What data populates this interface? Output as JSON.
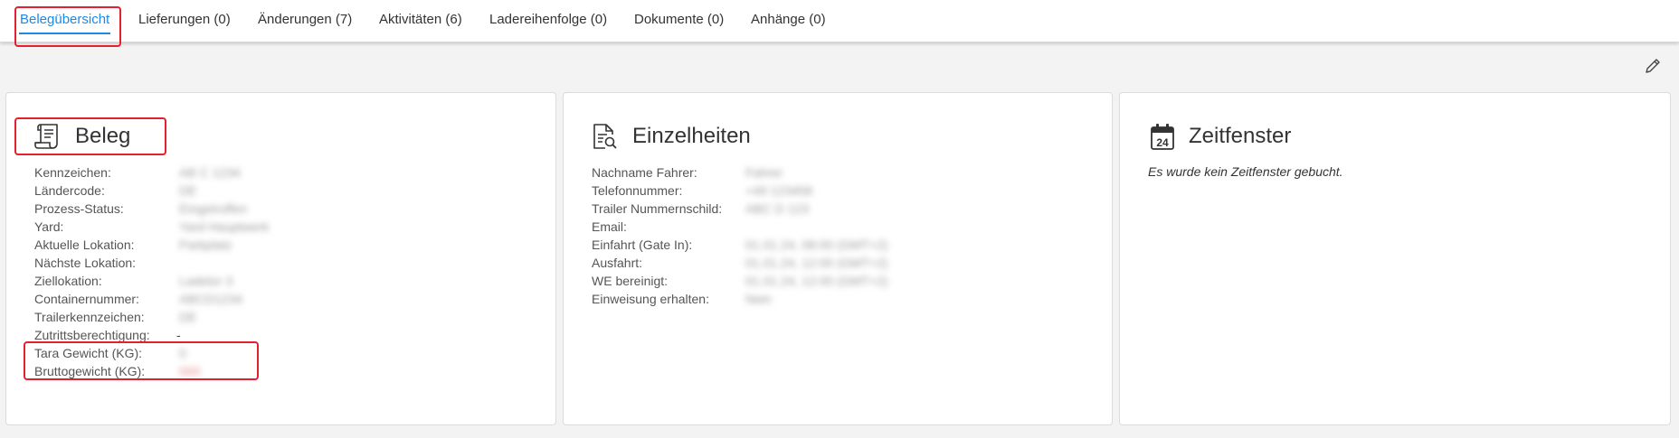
{
  "tabs": [
    {
      "label": "Belegübersicht",
      "active": true
    },
    {
      "label": "Lieferungen (0)"
    },
    {
      "label": "Änderungen (7)"
    },
    {
      "label": "Aktivitäten (6)"
    },
    {
      "label": "Ladereihenfolge (0)"
    },
    {
      "label": "Dokumente (0)"
    },
    {
      "label": "Anhänge (0)"
    }
  ],
  "edit_icon": "pencil-icon",
  "beleg": {
    "title": "Beleg",
    "icon": "receipt-icon",
    "rows": [
      {
        "label": "Kennzeichen:",
        "value": "AB C 1234"
      },
      {
        "label": "Ländercode:",
        "value": "DE"
      },
      {
        "label": "Prozess-Status:",
        "value": "Eingetroffen"
      },
      {
        "label": "Yard:",
        "value": "Yard Hauptwerk"
      },
      {
        "label": "Aktuelle Lokation:",
        "value": "Parkplatz"
      },
      {
        "label": "Nächste Lokation:",
        "value": ""
      },
      {
        "label": "Ziellokation:",
        "value": "Ladetor 3"
      },
      {
        "label": "Containernummer:",
        "value": "ABCD1234"
      },
      {
        "label": "Trailerkennzeichen:",
        "value": "DE"
      },
      {
        "label": "Zutrittsberechtigung:",
        "value": "-"
      },
      {
        "label": "Tara Gewicht (KG):",
        "value": "0"
      },
      {
        "label": "Bruttogewicht (KG):",
        "value": "000"
      }
    ]
  },
  "einzelheiten": {
    "title": "Einzelheiten",
    "icon": "document-search-icon",
    "rows": [
      {
        "label": "Nachname Fahrer:",
        "value": "Fahrer"
      },
      {
        "label": "Telefonnummer:",
        "value": "+49 123456"
      },
      {
        "label": "Trailer Nummernschild:",
        "value": "ABC D 123"
      },
      {
        "label": "Email:",
        "value": ""
      },
      {
        "label": "Einfahrt (Gate In):",
        "value": "01.01.24, 08:00 (GMT+2)"
      },
      {
        "label": "Ausfahrt:",
        "value": "01.01.24, 12:00 (GMT+2)"
      },
      {
        "label": "WE bereinigt:",
        "value": "01.01.24, 12:00 (GMT+2)"
      },
      {
        "label": "Einweisung erhalten:",
        "value": "Nein"
      }
    ]
  },
  "zeitfenster": {
    "title": "Zeitfenster",
    "icon": "calendar-icon",
    "calendar_day": "24",
    "note": "Es wurde kein Zeitfenster gebucht."
  }
}
